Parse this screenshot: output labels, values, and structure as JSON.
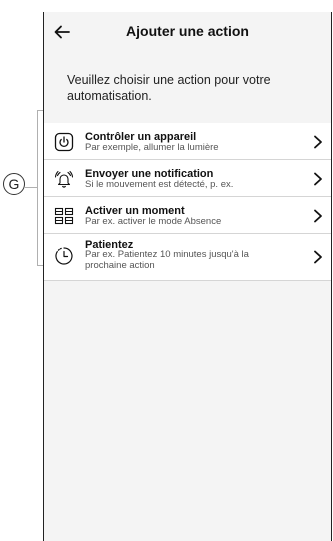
{
  "header": {
    "title": "Ajouter une action"
  },
  "intro": "Veuillez choisir une action pour votre automatisation.",
  "actions": [
    {
      "label": "Contrôler un appareil",
      "sub": "Par exemple, allumer la lumière",
      "icon": "power-icon"
    },
    {
      "label": "Envoyer une notification",
      "sub": "Si le mouvement est détecté, p. ex.",
      "icon": "bell-notification-icon"
    },
    {
      "label": "Activer un moment",
      "sub": "Par ex. activer le mode Absence",
      "icon": "moment-grid-icon"
    },
    {
      "label": "Patientez",
      "sub": "Par ex. Patientez 10 minutes jusqu'à la prochaine action",
      "icon": "timer-clock-icon"
    }
  ],
  "callout": {
    "label": "G"
  }
}
